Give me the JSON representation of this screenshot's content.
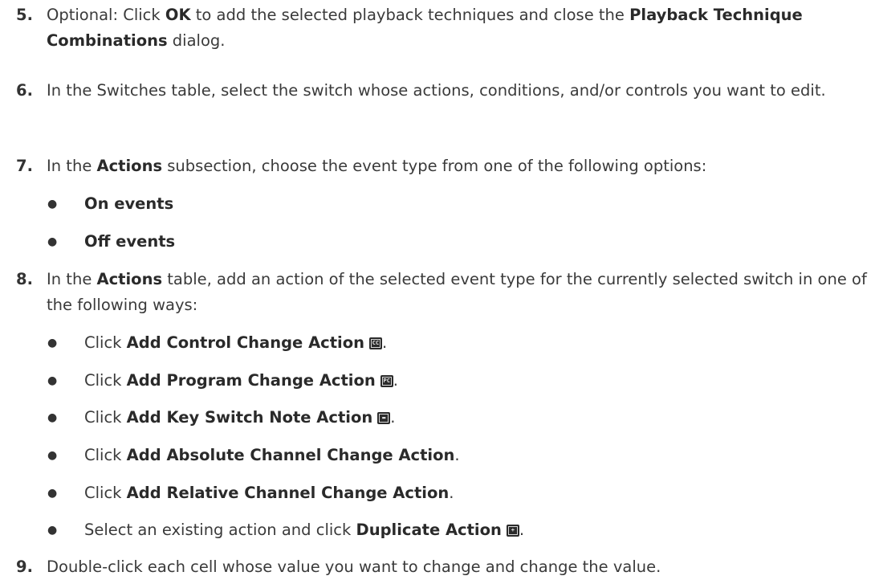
{
  "steps": [
    {
      "number": "5.",
      "parts": [
        "Optional: Click ",
        "OK",
        " to add the selected playback techniques and close the ",
        "Playback Technique Combinations",
        " dialog."
      ]
    },
    {
      "number": "6.",
      "text": "In the Switches table, select the switch whose actions, conditions, and/or controls you want to edit."
    },
    {
      "number": "7.",
      "parts": [
        "In the ",
        "Actions",
        " subsection, choose the event type from one of the following options:"
      ]
    },
    {
      "number": "8.",
      "parts": [
        "In the ",
        "Actions",
        " table, add an action of the selected event type for the currently selected switch in one of the following ways:"
      ]
    },
    {
      "number": "9.",
      "text": "Double-click each cell whose value you want to change and change the value."
    }
  ],
  "step7_options": [
    "On events",
    "Off events"
  ],
  "step8_options": [
    {
      "prefix": "Click ",
      "bold": "Add Control Change Action",
      "icon": "control-change-icon",
      "glyph": "CC",
      "suffix": "."
    },
    {
      "prefix": "Click ",
      "bold": "Add Program Change Action",
      "icon": "program-change-icon",
      "glyph": "PC",
      "suffix": "."
    },
    {
      "prefix": "Click ",
      "bold": "Add Key Switch Note Action",
      "icon": "key-switch-icon",
      "glyph": "▬",
      "suffix": "."
    },
    {
      "prefix": "Click ",
      "bold": "Add Absolute Channel Change Action",
      "suffix": "."
    },
    {
      "prefix": "Click ",
      "bold": "Add Relative Channel Change Action",
      "suffix": "."
    },
    {
      "prefix": "Select an existing action and click ",
      "bold": "Duplicate Action",
      "icon": "duplicate-icon",
      "glyph": "+",
      "suffix": "."
    }
  ],
  "bullet_glyph": "●"
}
